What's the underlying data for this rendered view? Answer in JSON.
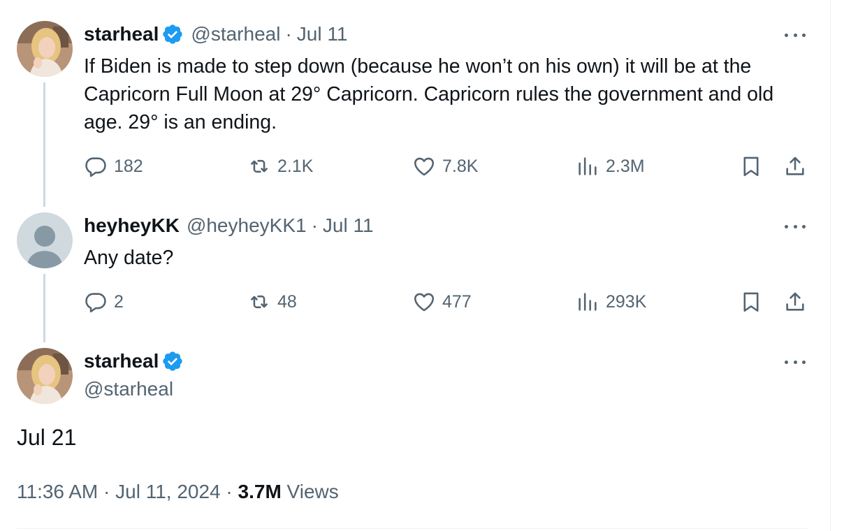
{
  "tweet1": {
    "name": "starheal",
    "handle": "@starheal",
    "sep": "·",
    "date": "Jul 11",
    "text": "If Biden is made to step down (because he won’t on his own) it will be at the Capricorn Full Moon at 29° Capricorn. Capricorn rules the government and old age. 29° is an ending.",
    "replies": "182",
    "reposts": "2.1K",
    "likes": "7.8K",
    "views": "2.3M"
  },
  "tweet2": {
    "name": "heyheyKK",
    "handle": "@heyheyKK1",
    "sep": "·",
    "date": "Jul 11",
    "text": "Any date?",
    "replies": "2",
    "reposts": "48",
    "likes": "477",
    "views": "293K"
  },
  "main": {
    "name": "starheal",
    "handle": "@starheal",
    "text": "Jul 21",
    "time": "11:36 AM",
    "sep1": "·",
    "date": "Jul 11, 2024",
    "sep2": "·",
    "views_count": "3.7M",
    "views_label": "Views"
  },
  "icons": {
    "reply": "reply-icon",
    "repost": "repost-icon",
    "like": "heart-icon",
    "views": "views-chart-icon",
    "bookmark": "bookmark-icon",
    "share": "share-icon",
    "more": "more-dots-icon",
    "verified": "verified-badge-icon"
  },
  "colors": {
    "verified": "#1d9bf0",
    "secondary_text": "#536471",
    "thread_line": "#cfd9de"
  }
}
